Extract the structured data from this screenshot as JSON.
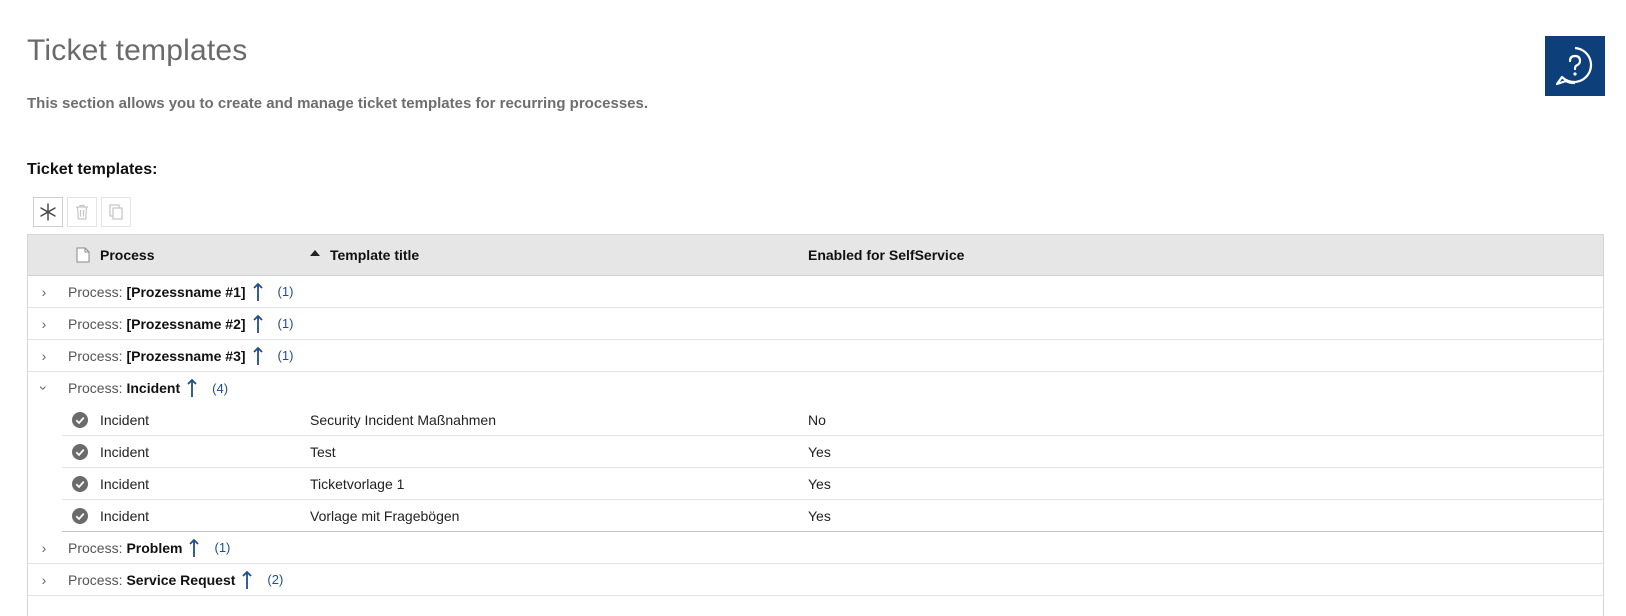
{
  "page": {
    "title": "Ticket templates",
    "description": "This section allows you to create and manage ticket templates for recurring processes.",
    "section_label": "Ticket templates:"
  },
  "colors": {
    "accent": "#0d3f7a",
    "link": "#1f4f8b",
    "header_bg": "#e6e6e6"
  },
  "toolbar": {
    "buttons": [
      {
        "icon": "asterisk-icon",
        "enabled": true
      },
      {
        "icon": "trash-icon",
        "enabled": false
      },
      {
        "icon": "copy-icon",
        "enabled": false
      }
    ]
  },
  "grid": {
    "columns": [
      {
        "label": "Process",
        "icon": "document-icon"
      },
      {
        "label": "Template title",
        "icon": "sort-ascending-icon"
      },
      {
        "label": "Enabled for SelfService"
      }
    ],
    "groups": [
      {
        "prefix": "Process:",
        "name": "[Prozessname #1]",
        "count": "(1)",
        "expanded": false
      },
      {
        "prefix": "Process:",
        "name": "[Prozessname #2]",
        "count": "(1)",
        "expanded": false
      },
      {
        "prefix": "Process:",
        "name": "[Prozessname #3]",
        "count": "(1)",
        "expanded": false
      },
      {
        "prefix": "Process:",
        "name": "Incident",
        "count": "(4)",
        "expanded": true,
        "rows": [
          {
            "process": "Incident",
            "title": "Security Incident Maßnahmen",
            "selfservice": "No"
          },
          {
            "process": "Incident",
            "title": "Test",
            "selfservice": "Yes"
          },
          {
            "process": "Incident",
            "title": "Ticketvorlage 1",
            "selfservice": "Yes"
          },
          {
            "process": "Incident",
            "title": "Vorlage mit Fragebögen",
            "selfservice": "Yes"
          }
        ]
      },
      {
        "prefix": "Process:",
        "name": "Problem",
        "count": "(1)",
        "expanded": false
      },
      {
        "prefix": "Process:",
        "name": "Service Request",
        "count": "(2)",
        "expanded": false
      }
    ]
  }
}
